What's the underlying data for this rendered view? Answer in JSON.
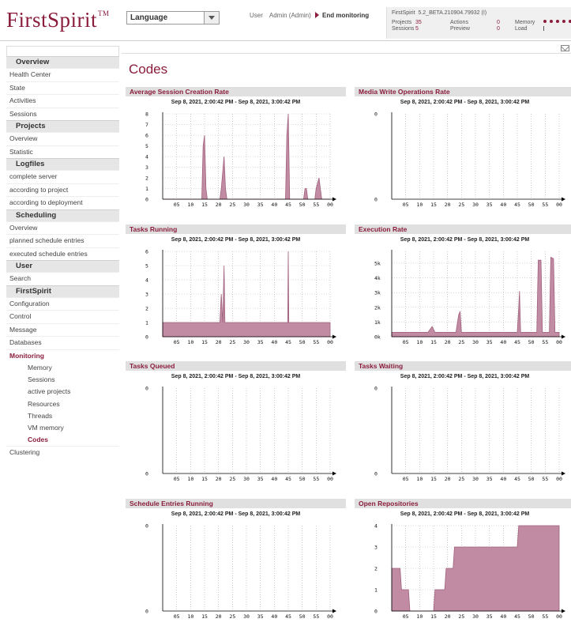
{
  "header": {
    "logo": "FirstSpirit",
    "logo_tm": "TM",
    "language": "Language",
    "user_label": "User",
    "user_name": "Admin (Admin)",
    "end_monitoring": "End monitoring",
    "version_label": "FirstSpirit",
    "version": "5.2_BETA.210904.79932 (I)",
    "projects_label": "Projects",
    "projects": "35",
    "sessions_label": "Sessions",
    "sessions": "5",
    "actions_label": "Actions",
    "actions": "0",
    "preview_label": "Preview",
    "preview": "0",
    "memory_label": "Memory",
    "load_label": "Load"
  },
  "sidebar": {
    "sections": [
      {
        "title": "Overview",
        "items": [
          "Health Center",
          "State",
          "Activities",
          "Sessions"
        ]
      },
      {
        "title": "Projects",
        "items": [
          "Overview",
          "Statistic"
        ]
      },
      {
        "title": "Logfiles",
        "items": [
          "complete server",
          "according to project",
          "according to deployment"
        ]
      },
      {
        "title": "Scheduling",
        "items": [
          "Overview",
          "planned schedule entries",
          "executed schedule entries"
        ]
      },
      {
        "title": "User",
        "items": [
          "Search"
        ]
      },
      {
        "title": "FirstSpirit",
        "items": [
          "Configuration",
          "Control",
          "Message",
          "Databases",
          "Monitoring"
        ]
      }
    ],
    "monitoring_sub": [
      "Memory",
      "Sessions",
      "active projects",
      "Resources",
      "Threads",
      "VM memory",
      "Codes"
    ],
    "active_sub": "Codes",
    "after": [
      "Clustering"
    ]
  },
  "page_title": "Codes",
  "colors": {
    "accent": "#8a1d3c",
    "fill": "#c18ca3",
    "stroke": "#a0607c"
  },
  "chart_data": [
    {
      "title": "Average Session Creation Rate",
      "range": "Sep 8, 2021, 2:00:42 PM - Sep 8, 2021, 3:00:42 PM",
      "type": "area",
      "y_ticks": [
        "0",
        "1",
        "2",
        "3",
        "4",
        "5",
        "6",
        "7",
        "8"
      ],
      "ylim": [
        0,
        8
      ],
      "x_ticks": [
        "05",
        "10",
        "15",
        "20",
        "25",
        "30",
        "35",
        "40",
        "45",
        "50",
        "55",
        "00"
      ],
      "points": [
        [
          0,
          0
        ],
        [
          14,
          0
        ],
        [
          14.5,
          5
        ],
        [
          15,
          6
        ],
        [
          15.5,
          1
        ],
        [
          16,
          0
        ],
        [
          20.5,
          0
        ],
        [
          21,
          1
        ],
        [
          22,
          4
        ],
        [
          22.5,
          1
        ],
        [
          23,
          0
        ],
        [
          44,
          0
        ],
        [
          44.5,
          6
        ],
        [
          45,
          8
        ],
        [
          45.5,
          0
        ],
        [
          50.5,
          0
        ],
        [
          51,
          1
        ],
        [
          51.5,
          1
        ],
        [
          52,
          0
        ],
        [
          54.5,
          0
        ],
        [
          55,
          1
        ],
        [
          56,
          2
        ],
        [
          56.5,
          1
        ],
        [
          57,
          0
        ],
        [
          60,
          0
        ]
      ]
    },
    {
      "title": "Media Write Operations Rate",
      "range": "Sep 8, 2021, 2:00:42 PM - Sep 8, 2021, 3:00:42 PM",
      "type": "area",
      "y_ticks": [
        "0",
        "0"
      ],
      "ylim": [
        0,
        1
      ],
      "x_ticks": [
        "05",
        "10",
        "15",
        "20",
        "25",
        "30",
        "35",
        "40",
        "45",
        "50",
        "55",
        "00"
      ],
      "points": []
    },
    {
      "title": "Tasks Running",
      "range": "Sep 8, 2021, 2:00:42 PM - Sep 8, 2021, 3:00:42 PM",
      "type": "area",
      "y_ticks": [
        "0",
        "1",
        "2",
        "3",
        "4",
        "5",
        "6"
      ],
      "ylim": [
        0,
        6
      ],
      "x_ticks": [
        "05",
        "10",
        "15",
        "20",
        "25",
        "30",
        "35",
        "40",
        "45",
        "50",
        "55",
        "00"
      ],
      "points": [
        [
          0,
          1
        ],
        [
          20.5,
          1
        ],
        [
          21,
          3
        ],
        [
          21.5,
          1
        ],
        [
          22,
          5
        ],
        [
          22.3,
          1
        ],
        [
          44.8,
          1
        ],
        [
          45,
          6
        ],
        [
          45.2,
          1
        ],
        [
          60,
          1
        ]
      ]
    },
    {
      "title": "Execution Rate",
      "range": "Sep 8, 2021, 2:00:42 PM - Sep 8, 2021, 3:00:42 PM",
      "type": "area",
      "y_ticks": [
        "0k",
        "1k",
        "2k",
        "3k",
        "4k",
        "5k"
      ],
      "ylim": [
        0,
        5800
      ],
      "x_ticks": [
        "05",
        "10",
        "15",
        "20",
        "25",
        "30",
        "35",
        "40",
        "45",
        "50",
        "55",
        "00"
      ],
      "points": [
        [
          0,
          300
        ],
        [
          13,
          300
        ],
        [
          14.5,
          700
        ],
        [
          15.5,
          300
        ],
        [
          23,
          300
        ],
        [
          24,
          1500
        ],
        [
          24.5,
          1700
        ],
        [
          25,
          300
        ],
        [
          45,
          300
        ],
        [
          45.5,
          2000
        ],
        [
          45.8,
          3100
        ],
        [
          46.2,
          300
        ],
        [
          52,
          300
        ],
        [
          52.5,
          5200
        ],
        [
          53.5,
          5200
        ],
        [
          54,
          300
        ],
        [
          56.5,
          300
        ],
        [
          57,
          5400
        ],
        [
          58,
          5300
        ],
        [
          58.5,
          300
        ],
        [
          60,
          300
        ]
      ]
    },
    {
      "title": "Tasks Queued",
      "range": "Sep 8, 2021, 2:00:42 PM - Sep 8, 2021, 3:00:42 PM",
      "type": "area",
      "y_ticks": [
        "0",
        "0"
      ],
      "ylim": [
        0,
        1
      ],
      "x_ticks": [
        "05",
        "10",
        "15",
        "20",
        "25",
        "30",
        "35",
        "40",
        "45",
        "50",
        "55",
        "00"
      ],
      "points": []
    },
    {
      "title": "Tasks Waiting",
      "range": "Sep 8, 2021, 2:00:42 PM - Sep 8, 2021, 3:00:42 PM",
      "type": "area",
      "y_ticks": [
        "0",
        "0"
      ],
      "ylim": [
        0,
        1
      ],
      "x_ticks": [
        "05",
        "10",
        "15",
        "20",
        "25",
        "30",
        "35",
        "40",
        "45",
        "50",
        "55",
        "00"
      ],
      "points": []
    },
    {
      "title": "Schedule Entries Running",
      "range": "Sep 8, 2021, 2:00:42 PM - Sep 8, 2021, 3:00:42 PM",
      "type": "area",
      "y_ticks": [
        "0",
        "0"
      ],
      "ylim": [
        0,
        1
      ],
      "x_ticks": [
        "05",
        "10",
        "15",
        "20",
        "25",
        "30",
        "35",
        "40",
        "45",
        "50",
        "55",
        "00"
      ],
      "points": []
    },
    {
      "title": "Open Repositories",
      "range": "Sep 8, 2021, 2:00:42 PM - Sep 8, 2021, 3:00:42 PM",
      "type": "area",
      "y_ticks": [
        "0",
        "1",
        "2",
        "3",
        "4"
      ],
      "ylim": [
        0,
        4
      ],
      "x_ticks": [
        "05",
        "10",
        "15",
        "20",
        "25",
        "30",
        "35",
        "40",
        "45",
        "50",
        "55",
        "00"
      ],
      "points": [
        [
          0,
          2
        ],
        [
          3,
          2
        ],
        [
          3.5,
          1
        ],
        [
          6,
          1
        ],
        [
          6.5,
          0
        ],
        [
          15,
          0
        ],
        [
          15.5,
          1
        ],
        [
          19,
          1
        ],
        [
          19.5,
          2
        ],
        [
          22,
          2
        ],
        [
          22.5,
          3
        ],
        [
          45,
          3
        ],
        [
          45.5,
          4
        ],
        [
          60,
          4
        ]
      ]
    }
  ]
}
